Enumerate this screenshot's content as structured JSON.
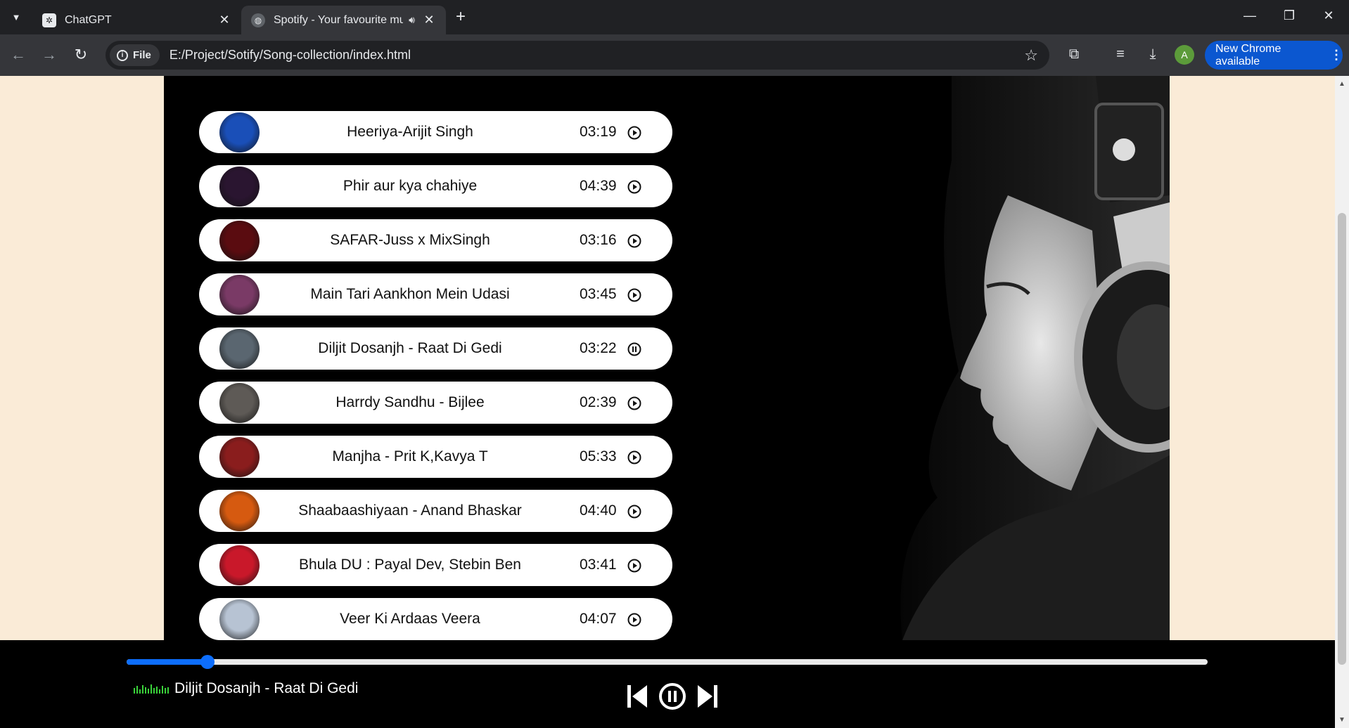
{
  "browser": {
    "tabs": [
      {
        "title": "ChatGPT",
        "active": false
      },
      {
        "title": "Spotify - Your favourite music",
        "active": true
      }
    ],
    "url_scheme": "File",
    "url": "E:/Project/Sotify/Song-collection/index.html",
    "profile_initial": "A",
    "update_label": "New Chrome available"
  },
  "songs": [
    {
      "name": "Heeriya-Arijit Singh",
      "duration": "03:19",
      "state": "play",
      "cover_color": "#1a4fb8"
    },
    {
      "name": "Phir aur kya chahiye",
      "duration": "04:39",
      "state": "play",
      "cover_color": "#2a1530"
    },
    {
      "name": "SAFAR-Juss x MixSingh",
      "duration": "03:16",
      "state": "play",
      "cover_color": "#5a0c10"
    },
    {
      "name": "Main Tari Aankhon Mein Udasi",
      "duration": "03:45",
      "state": "play",
      "cover_color": "#7a3a66"
    },
    {
      "name": "Diljit Dosanjh - Raat Di Gedi",
      "duration": "03:22",
      "state": "pause",
      "cover_color": "#5a6670"
    },
    {
      "name": "Harrdy Sandhu - Bijlee",
      "duration": "02:39",
      "state": "play",
      "cover_color": "#5e5a56"
    },
    {
      "name": "Manjha - Prit K,Kavya T",
      "duration": "05:33",
      "state": "play",
      "cover_color": "#8a1d1d"
    },
    {
      "name": "Shaabaashiyaan - Anand Bhaskar",
      "duration": "04:40",
      "state": "play",
      "cover_color": "#d65a10"
    },
    {
      "name": "Bhula DU : Payal Dev, Stebin Ben",
      "duration": "03:41",
      "state": "play",
      "cover_color": "#c9182a"
    },
    {
      "name": "Veer Ki Ardaas Veera",
      "duration": "04:07",
      "state": "play",
      "cover_color": "#b7c3d3"
    }
  ],
  "player": {
    "now_playing": "Diljit Dosanjh - Raat Di Gedi",
    "progress": 0.075,
    "state": "playing",
    "accent": "#0d6efd"
  }
}
